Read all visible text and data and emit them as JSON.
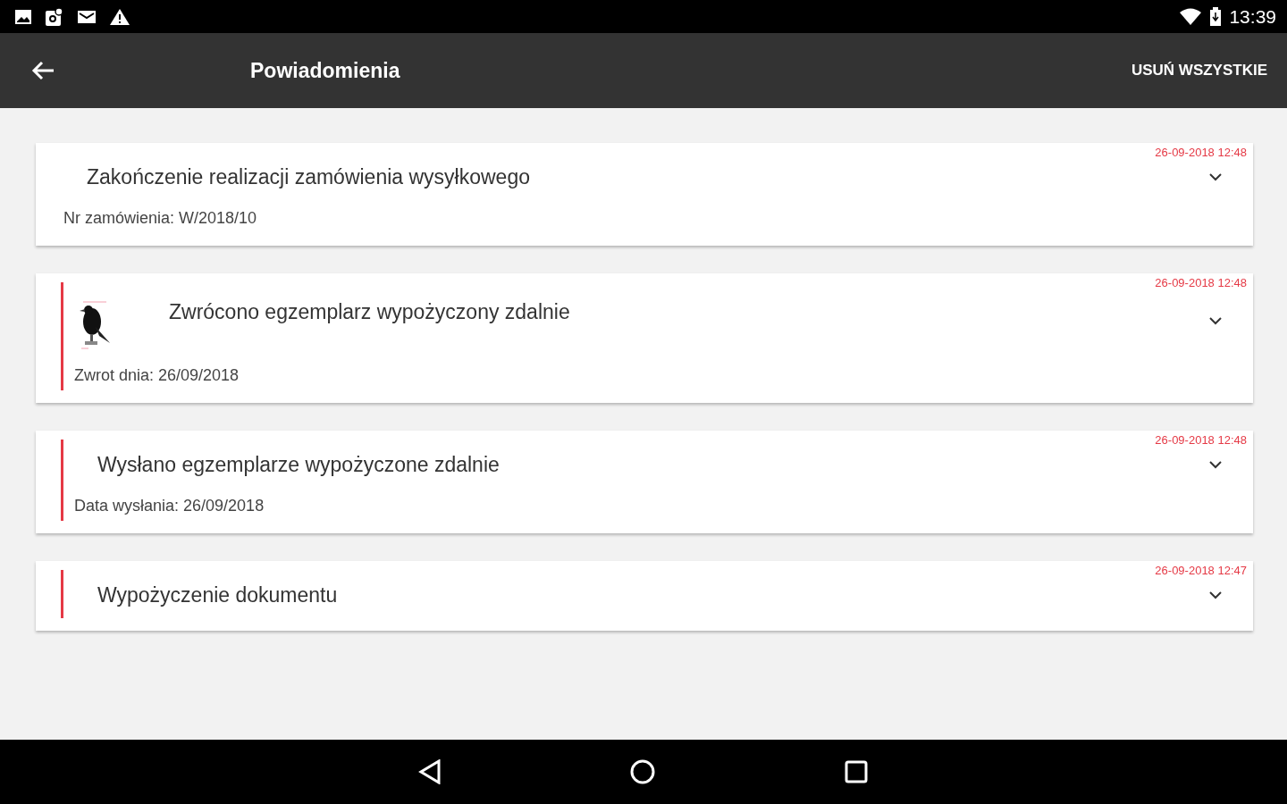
{
  "status_bar": {
    "time": "13:39"
  },
  "app_bar": {
    "title": "Powiadomienia",
    "action": "USUŃ WSZYSTKIE"
  },
  "notifications": [
    {
      "date": "26-09-2018 12:48",
      "title": "Zakończenie realizacji zamówienia wysyłkowego",
      "detail": "Nr zamówienia: W/2018/10",
      "flagged": false,
      "expanded": false
    },
    {
      "date": "26-09-2018 12:48",
      "title": "Zwrócono egzemplarz wypożyczony zdalnie",
      "detail": "Zwrot dnia: 26/09/2018",
      "flagged": true,
      "expanded": false
    },
    {
      "date": "26-09-2018 12:48",
      "title": "Wysłano egzemplarze wypożyczone zdalnie",
      "detail": "Data wysłania: 26/09/2018",
      "flagged": true,
      "expanded": false
    },
    {
      "date": "26-09-2018 12:47",
      "title": "Wypożyczenie dokumentu",
      "flagged": true,
      "expanded": false
    }
  ]
}
